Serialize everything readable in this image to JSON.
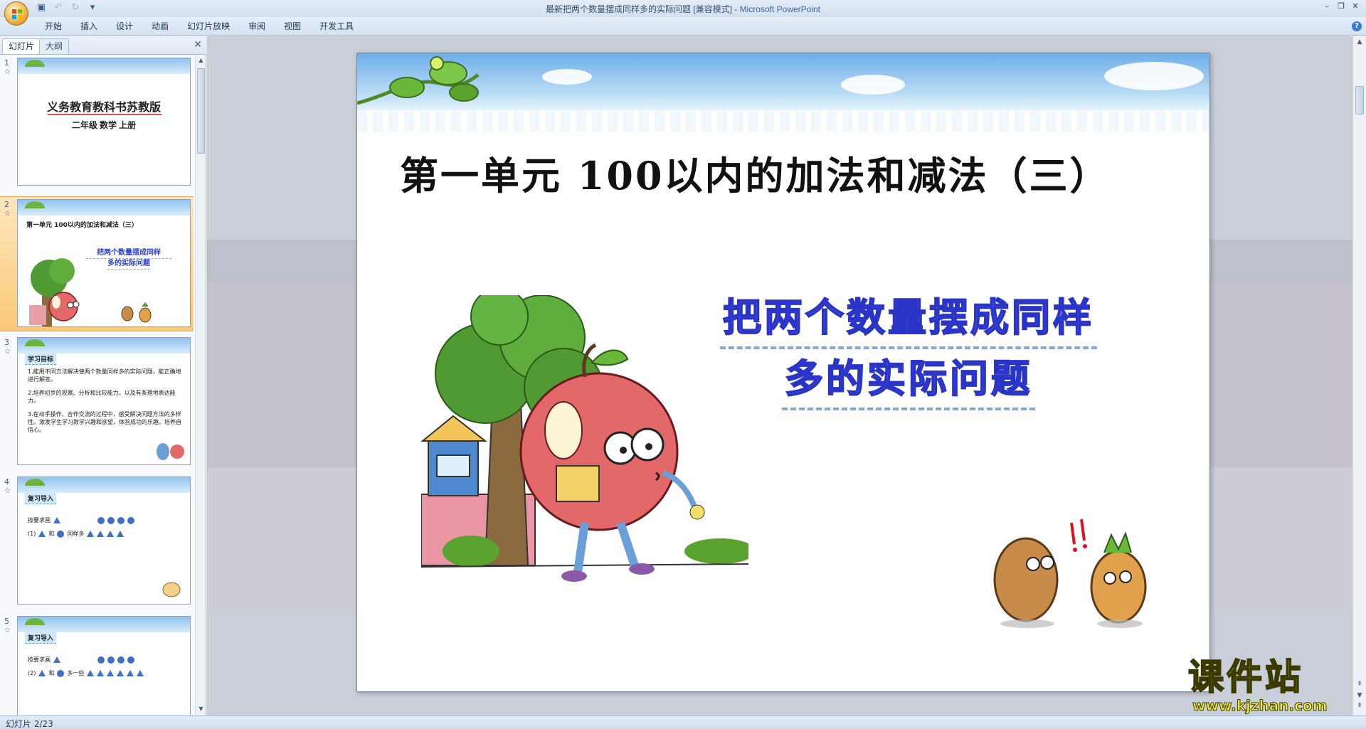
{
  "window": {
    "title": "最新把两个数量摆成同样多的实际问题 [兼容模式] - ",
    "app_name": "Microsoft PowerPoint"
  },
  "ribbon": {
    "tabs": [
      "开始",
      "插入",
      "设计",
      "动画",
      "幻灯片放映",
      "审阅",
      "视图",
      "开发工具"
    ]
  },
  "left_pane": {
    "tab_slides": "幻灯片",
    "tab_outline": "大纲"
  },
  "thumbnails": [
    {
      "num": "1",
      "title": "义务教育教科书苏教版",
      "subtitle": "二年级  数学  上册"
    },
    {
      "num": "2",
      "title": "第一单元  100以内的加法和减法（三）",
      "subtitle_line1": "把两个数量摆成同样",
      "subtitle_line2": "多的实际问题"
    },
    {
      "num": "3",
      "heading": "学习目标",
      "items": [
        "1.能用不同方法解决使两个数量同样多的实际问题，能正确地进行解答。",
        "2.培养初步的观察、分析和比较能力，以及有条理地表达能力。",
        "3.在动手操作、合作交流的过程中，感受解决问题方法的多样性。激发学生学习数学兴趣和欲望，体验成功的乐趣，培养自信心。"
      ]
    },
    {
      "num": "4",
      "heading": "复习导入",
      "line1": "按要求画",
      "line2_prefix": "(1)",
      "line2_mid": "和",
      "line2_suffix": "同样多"
    },
    {
      "num": "5",
      "heading": "复习导入",
      "line1": "按要求画",
      "line2_prefix": "(2)",
      "line2_mid": "和",
      "line2_suffix": "多一些"
    }
  ],
  "slide": {
    "title": "第一单元  100以内的加法和减法（三）",
    "subtitle_line1": "把两个数量摆成同样",
    "subtitle_line2": "多的实际问题"
  },
  "watermark": {
    "main": "课件站",
    "url": "www.kjzhan.com"
  },
  "status_bar": {
    "slide_indicator": "幻灯片 2/23"
  },
  "colors": {
    "subtitle_blue": "#5b63e8",
    "selected_thumb": "#fbc877",
    "ribbon": "#d5e2f2"
  }
}
